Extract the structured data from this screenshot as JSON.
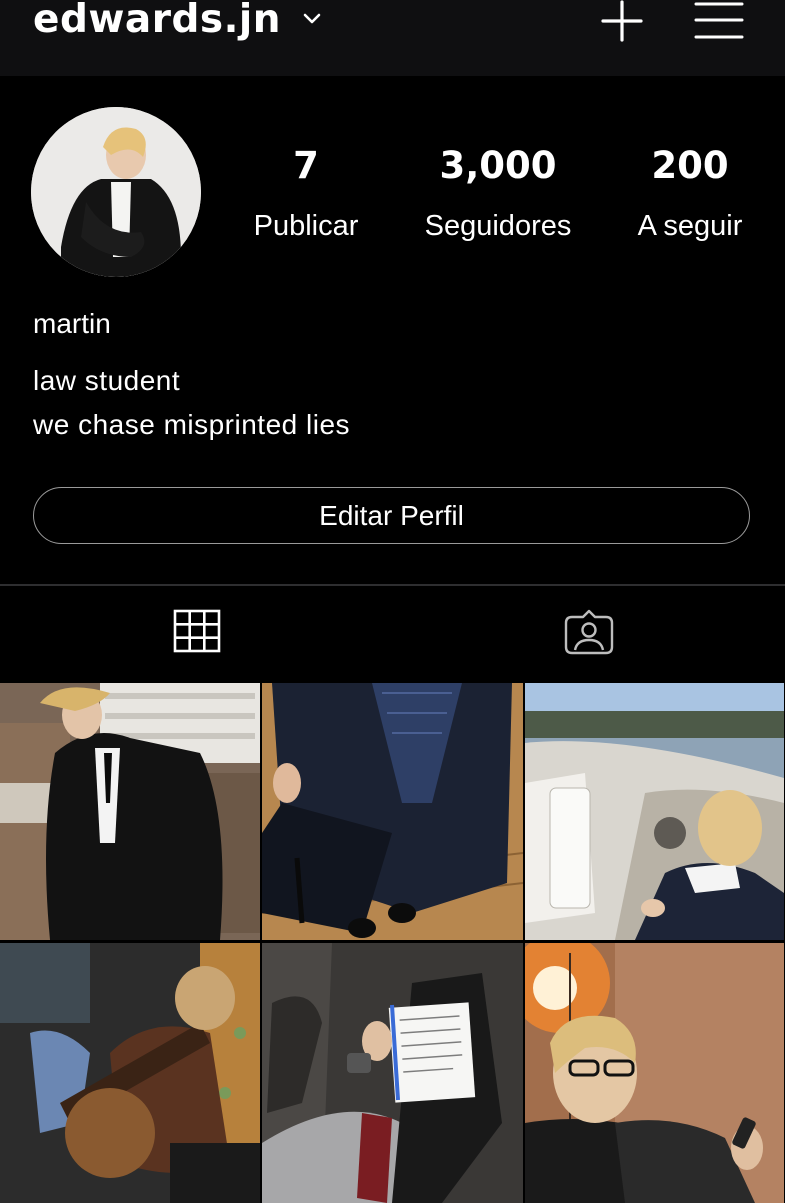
{
  "header": {
    "username": "edwards.jn",
    "icons": [
      "chevron-down-icon",
      "plus-icon",
      "menu-icon"
    ]
  },
  "profile": {
    "stats": {
      "posts": {
        "value": "7",
        "label": "Publicar"
      },
      "followers": {
        "value": "3,000",
        "label": "Seguidores"
      },
      "following": {
        "value": "200",
        "label": "A seguir"
      }
    },
    "name": "martin",
    "bio": [
      "law student",
      "we chase misprinted lies"
    ],
    "edit_button": "Editar Perfil"
  },
  "tabs": [
    {
      "icon": "grid-icon",
      "active": true
    },
    {
      "icon": "tagged-icon",
      "active": false
    }
  ],
  "posts": [
    {
      "description": "person in black suit against wooden crates"
    },
    {
      "description": "suit with graduation cap"
    },
    {
      "description": "person on a boat"
    },
    {
      "description": "person playing guitar"
    },
    {
      "description": "person holding documents in car"
    },
    {
      "description": "person with glasses holding phone"
    }
  ],
  "colors": {
    "background": "#000000",
    "topbar": "#0f0f11",
    "text": "#ffffff",
    "border": "#9a9a9a"
  }
}
